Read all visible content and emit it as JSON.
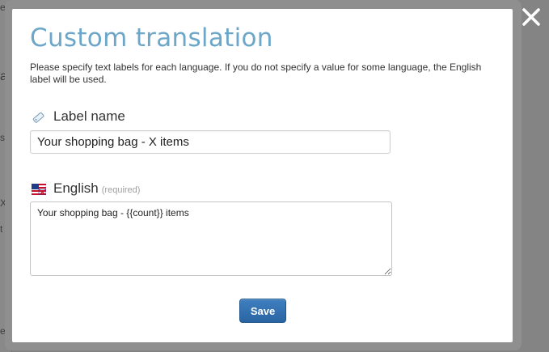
{
  "background": {
    "fragments": [
      "e",
      "a",
      "s",
      "X",
      "t",
      "e"
    ]
  },
  "modal": {
    "title": "Custom translation",
    "description": "Please specify text labels for each language. If you do not specify a value for some language, the English label will be used.",
    "label_name": {
      "label": "Label name",
      "icon": "tag-icon",
      "value": "Your shopping bag - X items"
    },
    "english": {
      "label": "English",
      "required_note": "(required)",
      "icon": "us-uk-flag-icon",
      "value": "Your shopping bag - {{count}} items"
    },
    "save_label": "Save",
    "close_icon": "close-icon"
  },
  "colors": {
    "title": "#6ca6c8",
    "save_button": "#2a64a3",
    "overlay": "#7a7a7a"
  }
}
